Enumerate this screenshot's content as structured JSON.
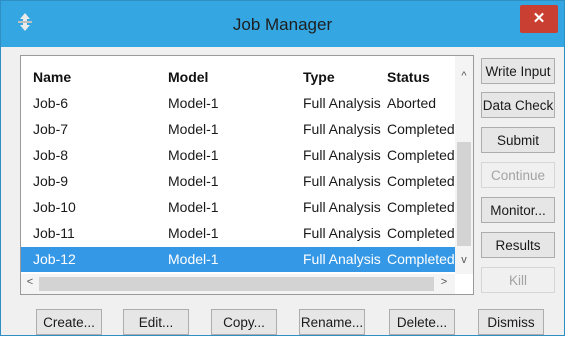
{
  "window": {
    "title": "Job Manager",
    "close_symbol": "✕"
  },
  "table": {
    "columns": [
      "Name",
      "Model",
      "Type",
      "Status"
    ],
    "rows": [
      {
        "name": "Job-6",
        "model": "Model-1",
        "type": "Full Analysis",
        "status": "Aborted"
      },
      {
        "name": "Job-7",
        "model": "Model-1",
        "type": "Full Analysis",
        "status": "Completed"
      },
      {
        "name": "Job-8",
        "model": "Model-1",
        "type": "Full Analysis",
        "status": "Completed"
      },
      {
        "name": "Job-9",
        "model": "Model-1",
        "type": "Full Analysis",
        "status": "Completed"
      },
      {
        "name": "Job-10",
        "model": "Model-1",
        "type": "Full Analysis",
        "status": "Completed"
      },
      {
        "name": "Job-11",
        "model": "Model-1",
        "type": "Full Analysis",
        "status": "Completed"
      },
      {
        "name": "Job-12",
        "model": "Model-1",
        "type": "Full Analysis",
        "status": "Completed"
      }
    ],
    "selected_row": "Job-12"
  },
  "scroll": {
    "up": "^",
    "down": "v",
    "left": "<",
    "right": ">"
  },
  "side_buttons": {
    "write_input": "Write Input",
    "data_check": "Data Check",
    "submit": "Submit",
    "continue": "Continue",
    "monitor": "Monitor...",
    "results": "Results",
    "kill": "Kill"
  },
  "bottom_buttons": {
    "create": "Create...",
    "edit": "Edit...",
    "copy": "Copy...",
    "rename": "Rename...",
    "delete": "Delete...",
    "dismiss": "Dismiss"
  },
  "colors": {
    "titlebar": "#34a7e3",
    "selection": "#3598e6",
    "close": "#c94032"
  }
}
